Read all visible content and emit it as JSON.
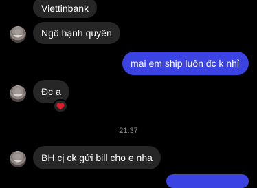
{
  "messages": [
    {
      "text": "Viettinbank",
      "side": "incoming"
    },
    {
      "text": "Ngô hạnh quyên",
      "side": "incoming"
    },
    {
      "text": "mai em ship luôn đc k nhỉ",
      "side": "outgoing"
    },
    {
      "text": "Đc ạ",
      "side": "incoming",
      "reaction": "heart-icon"
    },
    {
      "text": "BH cj ck gửi bill cho e nha",
      "side": "incoming"
    }
  ],
  "timestamp": "21:37",
  "colors": {
    "background": "#000000",
    "incoming_bubble": "#262626",
    "outgoing_bubble": "#3b44e3",
    "reaction_heart": "#e11d2b"
  }
}
